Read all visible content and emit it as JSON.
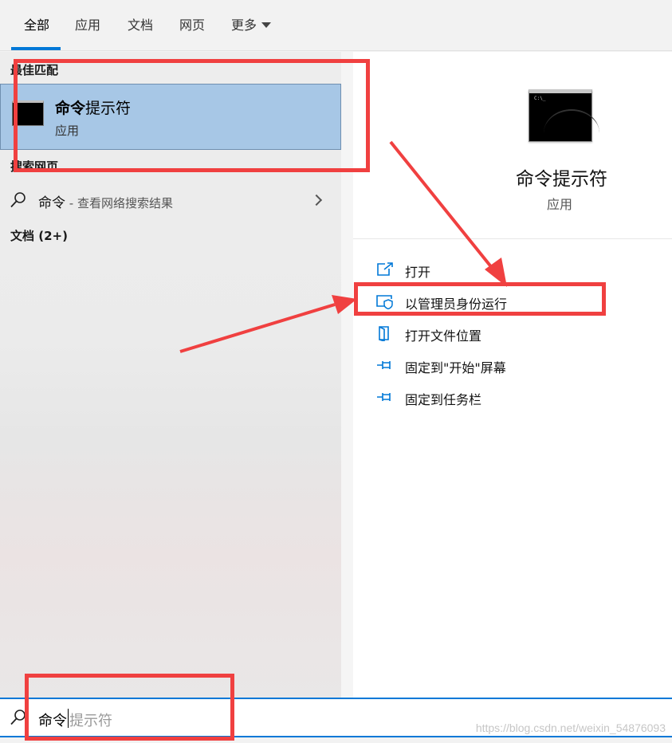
{
  "tabs": [
    {
      "label": "全部",
      "active": true
    },
    {
      "label": "应用",
      "active": false
    },
    {
      "label": "文档",
      "active": false
    },
    {
      "label": "网页",
      "active": false
    },
    {
      "label": "更多",
      "active": false
    }
  ],
  "left": {
    "best_match_header": "最佳匹配",
    "best_match": {
      "title_bold": "命令",
      "title_rest": "提示符",
      "subtitle": "应用",
      "icon": "command-prompt-icon"
    },
    "web_header": "搜索网页",
    "web_result": {
      "query": "命令",
      "hint": " - 查看网络搜索结果"
    },
    "docs_header": "文档 (2+)"
  },
  "right": {
    "app_name": "命令提示符",
    "app_type": "应用",
    "actions": [
      {
        "label": "打开",
        "icon": "open-icon"
      },
      {
        "label": "以管理员身份运行",
        "icon": "admin-shield-icon"
      },
      {
        "label": "打开文件位置",
        "icon": "file-location-icon"
      },
      {
        "label": "固定到\"开始\"屏幕",
        "icon": "pin-icon"
      },
      {
        "label": "固定到任务栏",
        "icon": "pin-icon"
      }
    ]
  },
  "search": {
    "typed": "命令",
    "suggestion": "提示符"
  },
  "watermark": "https://blog.csdn.net/weixin_54876093",
  "colors": {
    "accent": "#0078d7",
    "selected_bg": "#a7c7e6",
    "annotation": "#f04040"
  }
}
